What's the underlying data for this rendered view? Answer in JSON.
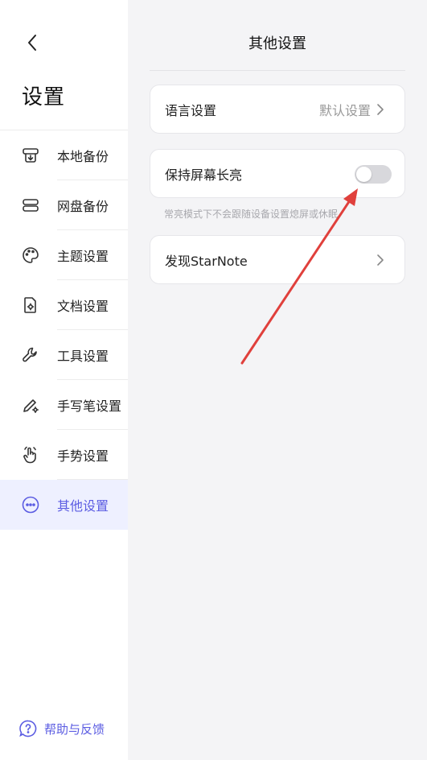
{
  "sidebar": {
    "title": "设置",
    "items": [
      {
        "label": "本地备份",
        "icon": "local-backup-icon"
      },
      {
        "label": "网盘备份",
        "icon": "cloud-drive-icon"
      },
      {
        "label": "主题设置",
        "icon": "palette-icon"
      },
      {
        "label": "文档设置",
        "icon": "document-gear-icon"
      },
      {
        "label": "工具设置",
        "icon": "wrench-icon"
      },
      {
        "label": "手写笔设置",
        "icon": "pen-gear-icon"
      },
      {
        "label": "手势设置",
        "icon": "hand-gesture-icon"
      },
      {
        "label": "其他设置",
        "icon": "more-circle-icon",
        "active": true
      }
    ],
    "help_label": "帮助与反馈"
  },
  "main": {
    "title": "其他设置",
    "language": {
      "label": "语言设置",
      "value": "默认设置"
    },
    "keep_screen_on": {
      "label": "保持屏幕长亮",
      "enabled": false,
      "hint": "常亮模式下不会跟随设备设置熄屏或休眠"
    },
    "discover": {
      "label": "发现StarNote"
    }
  },
  "colors": {
    "accent": "#5b5ce2",
    "annotation_arrow": "#e0403c",
    "active_bg": "#eef0ff"
  }
}
